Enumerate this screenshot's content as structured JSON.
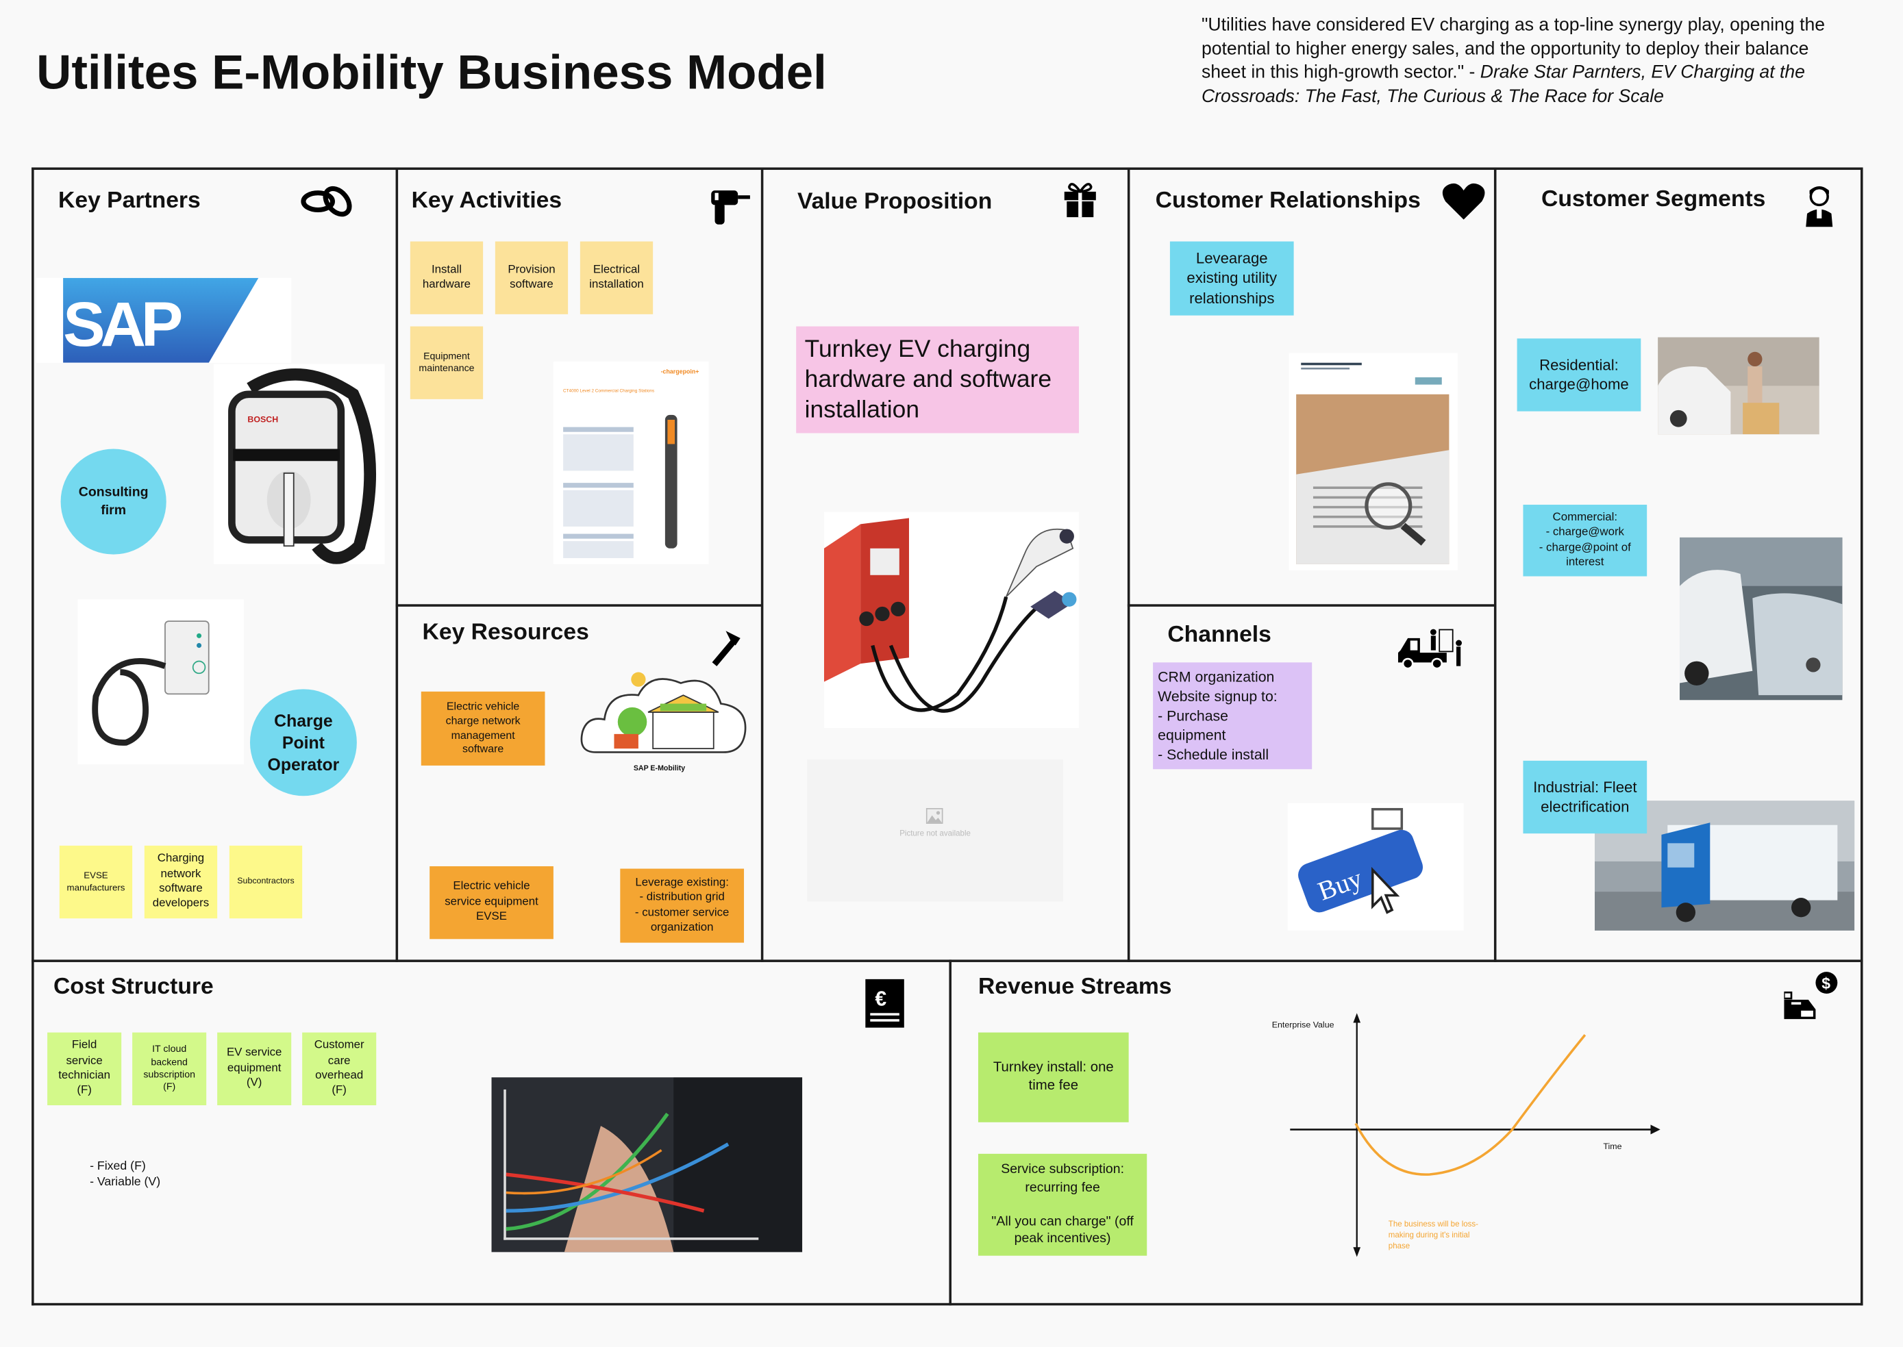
{
  "title": "Utilites E-Mobility Business Model",
  "quote": {
    "text": "\"Utilities have considered EV charging as a top-line synergy play, opening the potential to higher energy sales, and the opportunity to deploy their balance sheet in this high-growth sector.\" - ",
    "source": "Drake Star Parnters, EV Charging at the Crossroads: The Fast, The Curious & The Race for Scale"
  },
  "colors": {
    "partner_sticky": "#fdf98a",
    "activity_sticky": "#fce29a",
    "resource_sticky": "#f4a532",
    "value_sticky": "#f7c5e6",
    "relationship_sticky": "#74d9ef",
    "channel_sticky": "#dcc2f6",
    "cost_sticky": "#d3f98a",
    "revenue_sticky": "#b7eb6e",
    "curve": "#f4a532"
  },
  "key_partners": {
    "heading": "Key Partners",
    "icon": "handshake-rings-icon",
    "logo_text": "SAP",
    "bosch_label": "BOSCH",
    "circles": [
      "Consulting\nfirm",
      "Charge\nPoint\nOperator"
    ],
    "stickies": [
      "EVSE\nmanufacturers",
      "Charging\nnetwork\nsoftware\ndevelopers",
      "Subcontractors"
    ]
  },
  "key_activities": {
    "heading": "Key Activities",
    "icon": "drill-icon",
    "stickies": [
      "Install\nhardware",
      "Provision\nsoftware",
      "Electrical\ninstallation",
      "Equipment\nmaintenance"
    ],
    "doc_brand": "-chargepoin+",
    "doc_title": "CT4000 Level 2 Commercial Charging Stations"
  },
  "key_resources": {
    "heading": "Key Resources",
    "icon": "hammer-icon",
    "stickies": [
      "Electric vehicle\ncharge network\nmanagement\nsoftware",
      "Electric vehicle\nservice equipment\nEVSE",
      "Leverage existing:\n- distribution grid\n- customer service\norganization"
    ],
    "illustration_caption": "SAP E-Mobility"
  },
  "value_proposition": {
    "heading": "Value Proposition",
    "icon": "gift-icon",
    "sticky": "Turnkey EV charging hardware and software installation",
    "placeholder": "Picture not available"
  },
  "customer_relationships": {
    "heading": "Customer Relationships",
    "icon": "heart-icon",
    "sticky": "Levearage\nexisting utility\nrelationships"
  },
  "channels": {
    "heading": "Channels",
    "icon": "delivery-truck-icon",
    "sticky": "CRM organization\nWebsite signup to:\n- Purchase\nequipment\n- Schedule install",
    "buy_label": "Buy"
  },
  "customer_segments": {
    "heading": "Customer Segments",
    "icon": "person-icon",
    "stickies": [
      "Residential:\ncharge@home",
      "Commercial:\n- charge@work\n- charge@point of\ninterest",
      "Industrial: Fleet\nelectrification"
    ]
  },
  "cost_structure": {
    "heading": "Cost Structure",
    "icon": "euro-document-icon",
    "stickies": [
      "Field\nservice\ntechnician\n(F)",
      "IT cloud\nbackend\nsubscription\n(F)",
      "EV service\nequipment\n(V)",
      "Customer\ncare\noverhead\n(F)"
    ],
    "legend": [
      "- Fixed (F)",
      "- Variable (V)"
    ]
  },
  "revenue_streams": {
    "heading": "Revenue Streams",
    "icon": "cash-register-icon",
    "stickies": [
      "Turnkey install: one\ntime fee",
      "Service subscription:\nrecurring fee\n\n\"All you can charge\" (off\npeak incentives)"
    ],
    "graph": {
      "y_label": "Enterprise Value",
      "x_label": "Time",
      "annotation": "The business will be loss-\nmaking during it's initial\nphase"
    }
  }
}
